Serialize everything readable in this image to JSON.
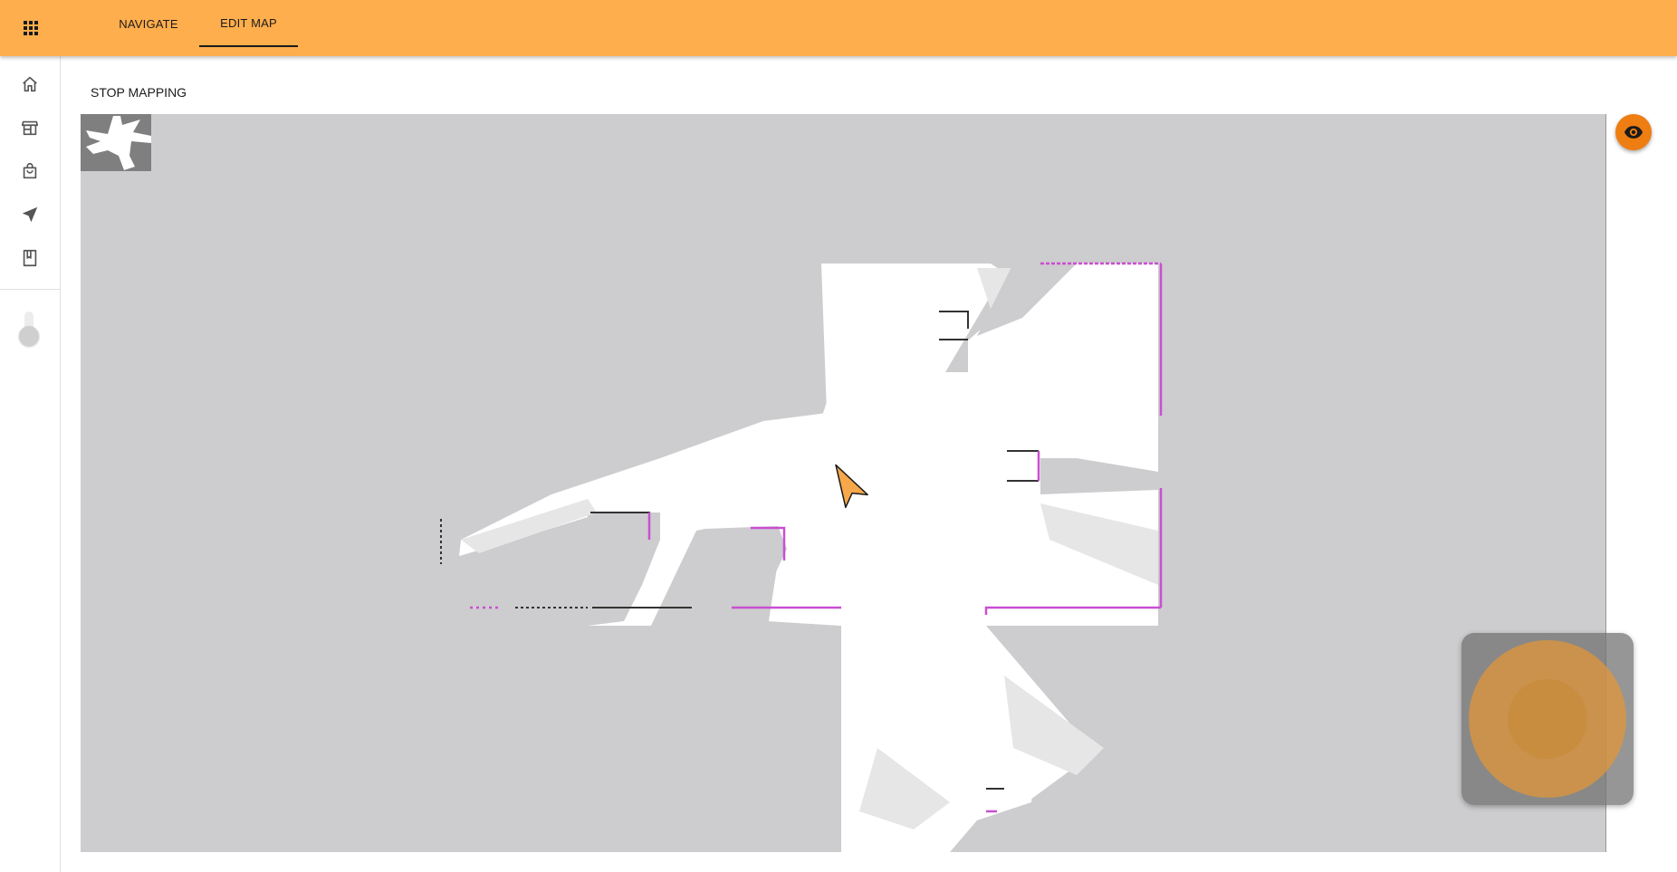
{
  "header": {
    "tabs": [
      {
        "label": "NAVIGATE",
        "active": false
      },
      {
        "label": "EDIT MAP",
        "active": true
      }
    ],
    "apps_icon": "apps-grid-icon",
    "accent_color": "#ffae4d"
  },
  "sidebar": {
    "items": [
      {
        "icon": "home-icon"
      },
      {
        "icon": "store-icon"
      },
      {
        "icon": "shopping-bag-icon"
      },
      {
        "icon": "navigation-arrow-icon"
      },
      {
        "icon": "bookmark-icon"
      }
    ],
    "toggle": {
      "on": false
    }
  },
  "toolbar": {
    "stop_mapping_label": "STOP MAPPING"
  },
  "map": {
    "background_color": "#cdccce",
    "free_space_color": "#ffffff",
    "obstacle_color": "#333333",
    "new_obstacle_color": "#c94fd1",
    "robot_color": "#f6a84a",
    "visibility_button": {
      "icon": "eye-icon",
      "color": "#ee7d12"
    }
  },
  "joystick": {
    "base_color": "#e0963a"
  }
}
